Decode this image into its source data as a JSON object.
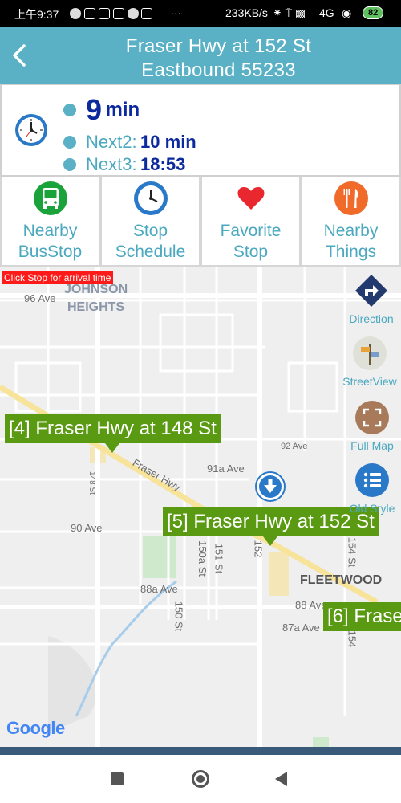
{
  "status_bar": {
    "time": "上午9:37",
    "network_speed": "233KB/s",
    "network_type": "4G",
    "battery": "82"
  },
  "header": {
    "title_line1": "Fraser Hwy at 152 St",
    "title_line2": "Eastbound 55233",
    "back_icon": "chevron-left-icon",
    "color": "#5ab0c4"
  },
  "arrivals": {
    "first": {
      "value": "9",
      "unit": "min"
    },
    "next2": {
      "label": "Next2:",
      "value": "10 min"
    },
    "next3": {
      "label": "Next3:",
      "value": "18:53"
    },
    "icon": "clock-icon",
    "accent": "#0c2a9e"
  },
  "actions": [
    {
      "line1": "Nearby",
      "line2": "BusStop",
      "icon": "bus-icon",
      "color": "#1aa33a"
    },
    {
      "line1": "Stop",
      "line2": "Schedule",
      "icon": "clock-icon",
      "color": "#2a78c8"
    },
    {
      "line1": "Favorite",
      "line2": "Stop",
      "icon": "heart-icon",
      "color": "#e8272e"
    },
    {
      "line1": "Nearby",
      "line2": "Things",
      "icon": "cutlery-icon",
      "color": "#f06a2a"
    }
  ],
  "map": {
    "hint": "Click Stop for arrival time",
    "stops": [
      {
        "label": "[4] Fraser Hwy at 148 St"
      },
      {
        "label": "[5] Fraser Hwy at 152 St"
      },
      {
        "label": "[6] Frase"
      }
    ],
    "labels": {
      "johnson": "JOHNSON",
      "heights": "HEIGHTS",
      "ave96": "96 Ave",
      "fraser_hwy": "Fraser Hwy",
      "ave92": "92 Ave",
      "ave91a": "91a Ave",
      "ave90": "90 Ave",
      "ave88a": "88a Ave",
      "ave88": "88 Ave",
      "ave87a": "87a Ave",
      "st148": "148 St",
      "st150": "150 St",
      "st150a": "150a St",
      "st151": "151 St",
      "st152": "152",
      "st154": "154 St",
      "st154b": "154",
      "fleetwood": "FLEETWOOD"
    },
    "side_buttons": [
      {
        "caption": "Direction",
        "icon": "direction-icon"
      },
      {
        "caption": "StreetView",
        "icon": "streetview-icon"
      },
      {
        "caption": "Full  Map",
        "icon": "fullscreen-icon"
      },
      {
        "caption": "Old Style",
        "icon": "list-icon"
      }
    ],
    "attribution": "Google"
  }
}
